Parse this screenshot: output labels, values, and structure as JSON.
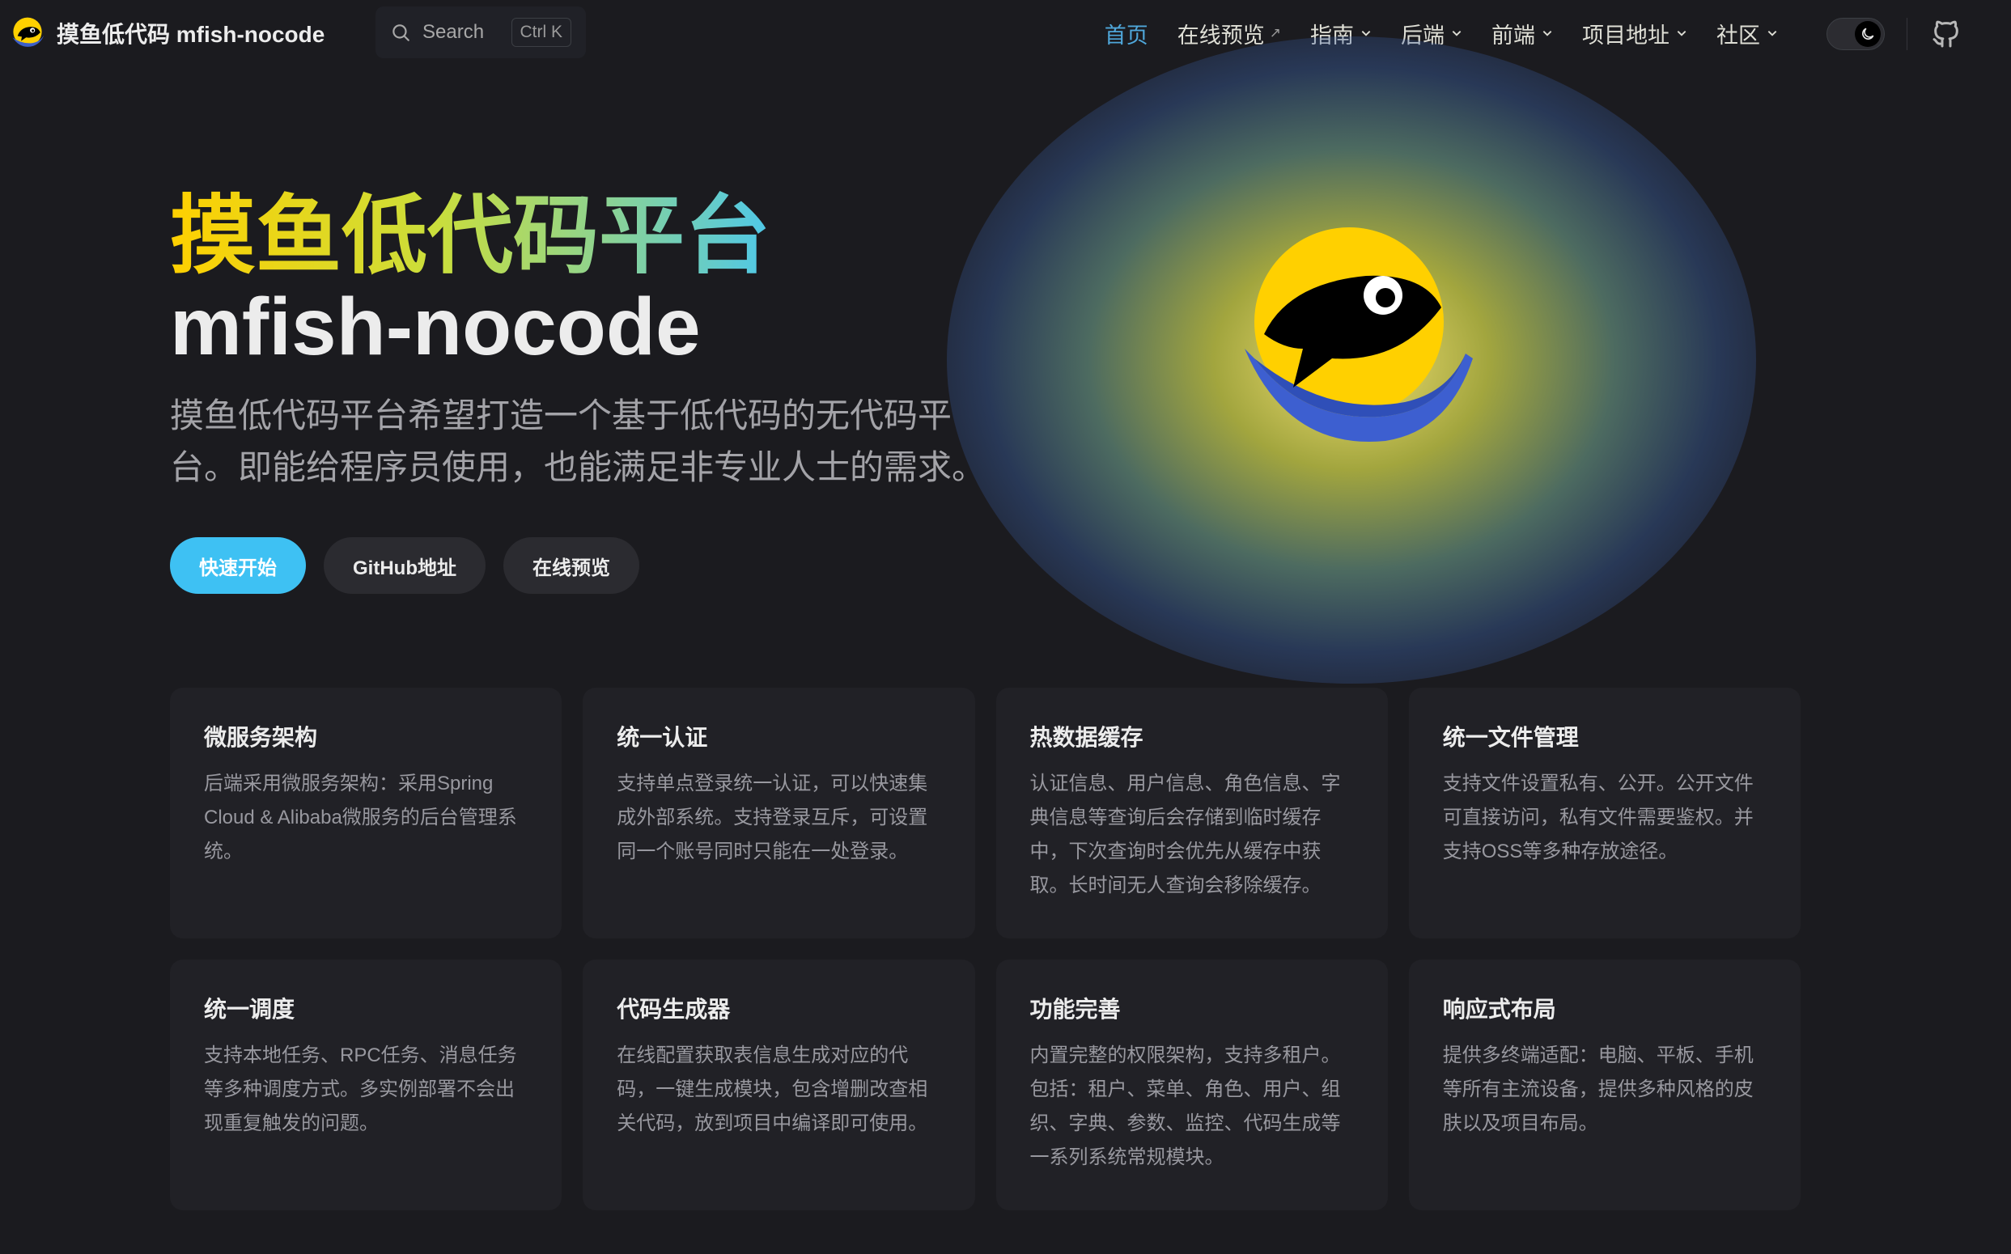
{
  "colors": {
    "background": "#1b1b1f",
    "card": "#212126",
    "brand": "#3ec1f3",
    "nav_active": "#4fa7da",
    "text": "#dfdfd6",
    "muted_text": "#98989f"
  },
  "navbar": {
    "site_title": "摸鱼低代码 mfish-nocode",
    "logo_icon": "fish-logo-icon",
    "search": {
      "label": "Search",
      "shortcut": "Ctrl K"
    },
    "menu": [
      {
        "label": "首页",
        "active": true,
        "type": "link"
      },
      {
        "label": "在线预览",
        "external_mark": "↗",
        "type": "external-link"
      },
      {
        "label": "指南",
        "type": "dropdown"
      },
      {
        "label": "后端",
        "type": "dropdown"
      },
      {
        "label": "前端",
        "type": "dropdown"
      },
      {
        "label": "项目地址",
        "type": "dropdown"
      },
      {
        "label": "社区",
        "type": "dropdown"
      }
    ],
    "theme_toggle_icon": "moon-icon",
    "social_icon": "github-icon"
  },
  "hero": {
    "name": "摸鱼低代码平台",
    "text": "mfish-nocode",
    "tagline": "摸鱼低代码平台希望打造一个基于低代码的无代码平台。即能给程序员使用，也能满足非专业人士的需求。",
    "actions": [
      {
        "label": "快速开始",
        "theme": "brand"
      },
      {
        "label": "GitHub地址",
        "theme": "alt"
      },
      {
        "label": "在线预览",
        "theme": "alt"
      }
    ]
  },
  "features": [
    {
      "title": "微服务架构",
      "details": "后端采用微服务架构：采用Spring Cloud & Alibaba微服务的后台管理系统。"
    },
    {
      "title": "统一认证",
      "details": "支持单点登录统一认证，可以快速集成外部系统。支持登录互斥，可设置同一个账号同时只能在一处登录。"
    },
    {
      "title": "热数据缓存",
      "details": "认证信息、用户信息、角色信息、字典信息等查询后会存储到临时缓存中，下次查询时会优先从缓存中获取。长时间无人查询会移除缓存。"
    },
    {
      "title": "统一文件管理",
      "details": "支持文件设置私有、公开。公开文件可直接访问，私有文件需要鉴权。并支持OSS等多种存放途径。"
    },
    {
      "title": "统一调度",
      "details": "支持本地任务、RPC任务、消息任务等多种调度方式。多实例部署不会出现重复触发的问题。"
    },
    {
      "title": "代码生成器",
      "details": "在线配置获取表信息生成对应的代码，一键生成模块，包含增删改查相关代码，放到项目中编译即可使用。"
    },
    {
      "title": "功能完善",
      "details": "内置完整的权限架构，支持多租户。包括：租户、菜单、角色、用户、组织、字典、参数、监控、代码生成等一系列系统常规模块。"
    },
    {
      "title": "响应式布局",
      "details": "提供多终端适配：电脑、平板、手机等所有主流设备，提供多种风格的皮肤以及项目布局。"
    }
  ]
}
